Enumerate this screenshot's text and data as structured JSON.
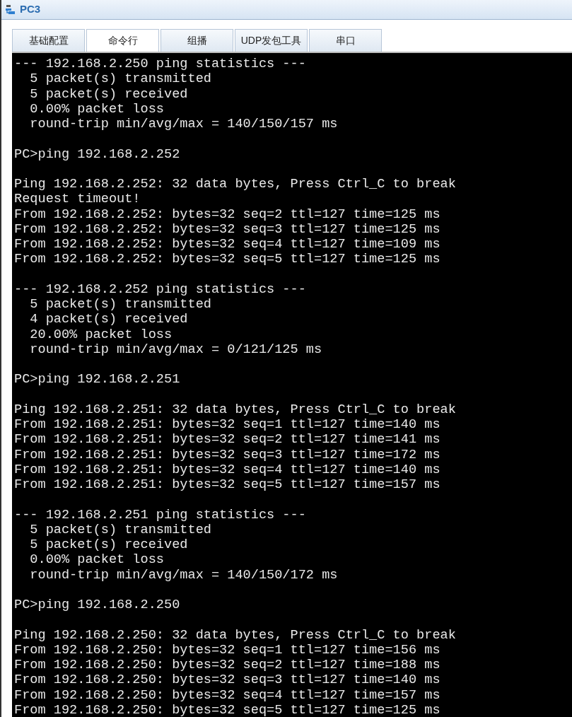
{
  "window": {
    "title": "PC3"
  },
  "tabs": [
    {
      "label": "基础配置",
      "selected": false
    },
    {
      "label": "命令行",
      "selected": true
    },
    {
      "label": "组播",
      "selected": false
    },
    {
      "label": "UDP发包工具",
      "selected": false
    },
    {
      "label": "串口",
      "selected": false
    }
  ],
  "terminal": {
    "blocks": [
      [
        "--- 192.168.2.250 ping statistics ---",
        "  5 packet(s) transmitted",
        "  5 packet(s) received",
        "  0.00% packet loss",
        "  round-trip min/avg/max = 140/150/157 ms"
      ],
      [
        "PC>ping 192.168.2.252"
      ],
      [
        "Ping 192.168.2.252: 32 data bytes, Press Ctrl_C to break",
        "Request timeout!",
        "From 192.168.2.252: bytes=32 seq=2 ttl=127 time=125 ms",
        "From 192.168.2.252: bytes=32 seq=3 ttl=127 time=125 ms",
        "From 192.168.2.252: bytes=32 seq=4 ttl=127 time=109 ms",
        "From 192.168.2.252: bytes=32 seq=5 ttl=127 time=125 ms"
      ],
      [
        "--- 192.168.2.252 ping statistics ---",
        "  5 packet(s) transmitted",
        "  4 packet(s) received",
        "  20.00% packet loss",
        "  round-trip min/avg/max = 0/121/125 ms"
      ],
      [
        "PC>ping 192.168.2.251"
      ],
      [
        "Ping 192.168.2.251: 32 data bytes, Press Ctrl_C to break",
        "From 192.168.2.251: bytes=32 seq=1 ttl=127 time=140 ms",
        "From 192.168.2.251: bytes=32 seq=2 ttl=127 time=141 ms",
        "From 192.168.2.251: bytes=32 seq=3 ttl=127 time=172 ms",
        "From 192.168.2.251: bytes=32 seq=4 ttl=127 time=140 ms",
        "From 192.168.2.251: bytes=32 seq=5 ttl=127 time=157 ms"
      ],
      [
        "--- 192.168.2.251 ping statistics ---",
        "  5 packet(s) transmitted",
        "  5 packet(s) received",
        "  0.00% packet loss",
        "  round-trip min/avg/max = 140/150/172 ms"
      ],
      [
        "PC>ping 192.168.2.250"
      ],
      [
        "Ping 192.168.2.250: 32 data bytes, Press Ctrl_C to break",
        "From 192.168.2.250: bytes=32 seq=1 ttl=127 time=156 ms",
        "From 192.168.2.250: bytes=32 seq=2 ttl=127 time=188 ms",
        "From 192.168.2.250: bytes=32 seq=3 ttl=127 time=140 ms",
        "From 192.168.2.250: bytes=32 seq=4 ttl=127 time=157 ms",
        "From 192.168.2.250: bytes=32 seq=5 ttl=127 time=125 ms"
      ]
    ]
  }
}
